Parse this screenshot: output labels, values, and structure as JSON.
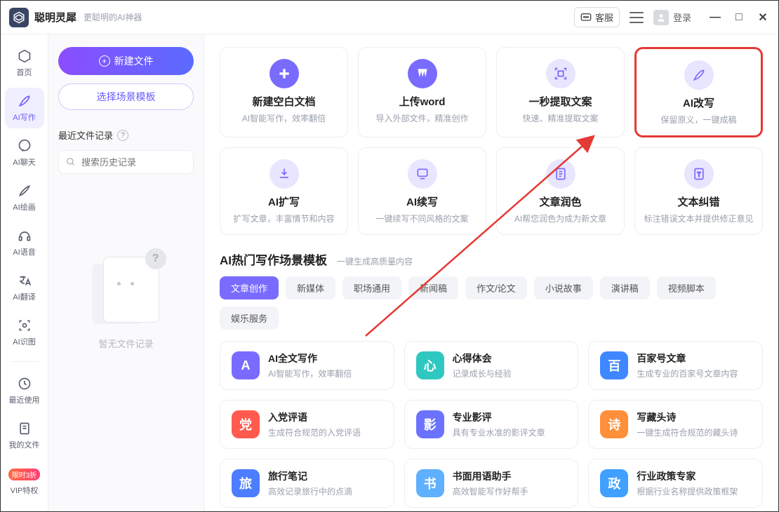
{
  "app": {
    "title": "聪明灵犀",
    "subtitle": "更聪明的AI神器"
  },
  "titlebar": {
    "support_label": "客服",
    "login_label": "登录"
  },
  "sidebar": {
    "items": [
      {
        "label": "首页"
      },
      {
        "label": "AI写作"
      },
      {
        "label": "AI聊天"
      },
      {
        "label": "AI绘画"
      },
      {
        "label": "AI语音"
      },
      {
        "label": "AI翻译"
      },
      {
        "label": "AI识图"
      }
    ],
    "recent_label": "最近使用",
    "myfiles_label": "我的文件",
    "vip_badge": "限时3折",
    "vip_label": "VIP特权"
  },
  "panel": {
    "new_file_label": "新建文件",
    "choose_template_label": "选择场景模板",
    "recent_heading": "最近文件记录",
    "search_placeholder": "搜索历史记录",
    "empty_text": "暂无文件记录"
  },
  "tools_row1": [
    {
      "title": "新建空白文档",
      "desc": "AI智能写作，效率翻倍"
    },
    {
      "title": "上传word",
      "desc": "导入外部文件，精准创作"
    },
    {
      "title": "一秒提取文案",
      "desc": "快速、精准提取文案"
    },
    {
      "title": "AI改写",
      "desc": "保留原义，一键成稿"
    }
  ],
  "tools_row2": [
    {
      "title": "AI扩写",
      "desc": "扩写文章，丰富情节和内容"
    },
    {
      "title": "AI续写",
      "desc": "一键续写不同风格的文案"
    },
    {
      "title": "文章润色",
      "desc": "AI帮您润色为成为新文章"
    },
    {
      "title": "文本纠错",
      "desc": "标注错误文本并提供修正意见"
    }
  ],
  "section": {
    "title": "AI热门写作场景模板",
    "subtitle": "一键生成高质量内容"
  },
  "tabs": [
    "文章创作",
    "新媒体",
    "职场通用",
    "新闻稿",
    "作文/论文",
    "小说故事",
    "演讲稿",
    "视频脚本",
    "娱乐服务"
  ],
  "templates": [
    {
      "title": "AI全文写作",
      "desc": "AI智能写作，效率翻倍",
      "color": "#7a6bff",
      "g": "A"
    },
    {
      "title": "心得体会",
      "desc": "记录成长与经验",
      "color": "#2fc8c1",
      "g": "心"
    },
    {
      "title": "百家号文章",
      "desc": "生成专业的百家号文章内容",
      "color": "#3f87ff",
      "g": "百"
    },
    {
      "title": "入党评语",
      "desc": "生成符合规范的入党评语",
      "color": "#ff5a4d",
      "g": "党"
    },
    {
      "title": "专业影评",
      "desc": "具有专业水准的影评文章",
      "color": "#6b72ff",
      "g": "影"
    },
    {
      "title": "写藏头诗",
      "desc": "一键生成符合规范的藏头诗",
      "color": "#ff8f3a",
      "g": "诗"
    },
    {
      "title": "旅行笔记",
      "desc": "高效记录旅行中的点滴",
      "color": "#4d7dff",
      "g": "旅"
    },
    {
      "title": "书面用语助手",
      "desc": "高效智能写作好帮手",
      "color": "#5fb0ff",
      "g": "书"
    },
    {
      "title": "行业政策专家",
      "desc": "根据行业名称提供政策框架",
      "color": "#3fa0ff",
      "g": "政"
    }
  ]
}
